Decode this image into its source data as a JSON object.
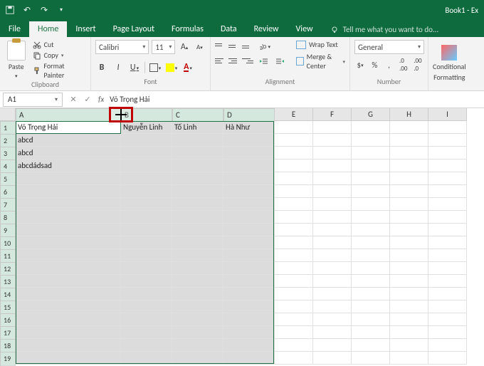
{
  "titlebar": {
    "title": "Book1 - Ex"
  },
  "tabs": {
    "file": "File",
    "home": "Home",
    "insert": "Insert",
    "pagelayout": "Page Layout",
    "formulas": "Formulas",
    "data": "Data",
    "review": "Review",
    "view": "View",
    "tellme": "Tell me what you want to do..."
  },
  "ribbon": {
    "clipboard": {
      "label": "Clipboard",
      "paste": "Paste",
      "cut": "Cut",
      "copy": "Copy",
      "painter": "Format Painter"
    },
    "font": {
      "label": "Font",
      "name": "Calibri",
      "size": "11"
    },
    "alignment": {
      "label": "Alignment",
      "wrap": "Wrap Text",
      "merge": "Merge & Center"
    },
    "number": {
      "label": "Number",
      "format": "General"
    },
    "styles": {
      "conditional": "Conditional",
      "formatting": "Formatting"
    }
  },
  "namebox": {
    "ref": "A1"
  },
  "formula": {
    "value": "Võ Trọng Hải"
  },
  "columns": [
    "A",
    "B",
    "C",
    "D",
    "E",
    "F",
    "G",
    "H",
    "I"
  ],
  "cells": {
    "A1": "Võ Trọng Hải",
    "B1": "Nguyễn Linh",
    "C1": "Tố Linh",
    "D1": "Hà Như",
    "A2": "abcd",
    "A3": "abcd",
    "A4": "abcdádsad"
  },
  "selected_cols": [
    "A",
    "B",
    "C",
    "D"
  ],
  "active_cell": "A1",
  "row_count": 19
}
